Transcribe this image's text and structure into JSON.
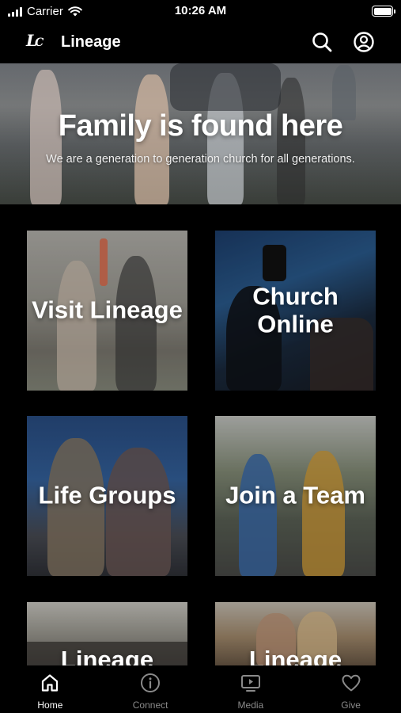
{
  "status_bar": {
    "carrier": "Carrier",
    "time": "10:26 AM"
  },
  "header": {
    "logo_text": "LC",
    "title": "Lineage",
    "search_icon": "search-icon",
    "profile_icon": "profile-icon"
  },
  "hero": {
    "title": "Family is found here",
    "subtitle": "We are a generation to generation church for all generations."
  },
  "tiles": [
    {
      "label": "Visit Lineage"
    },
    {
      "label": "Church Online"
    },
    {
      "label": "Life Groups"
    },
    {
      "label": "Join a Team"
    },
    {
      "label": "Lineage"
    },
    {
      "label": "Lineage"
    }
  ],
  "tabbar": {
    "items": [
      {
        "label": "Home",
        "icon": "home-icon",
        "active": true
      },
      {
        "label": "Connect",
        "icon": "info-icon",
        "active": false
      },
      {
        "label": "Media",
        "icon": "tv-play-icon",
        "active": false
      },
      {
        "label": "Give",
        "icon": "heart-icon",
        "active": false
      }
    ]
  },
  "colors": {
    "background": "#000000",
    "active_tab": "#ffffff",
    "inactive_tab": "#8a8a8a"
  }
}
